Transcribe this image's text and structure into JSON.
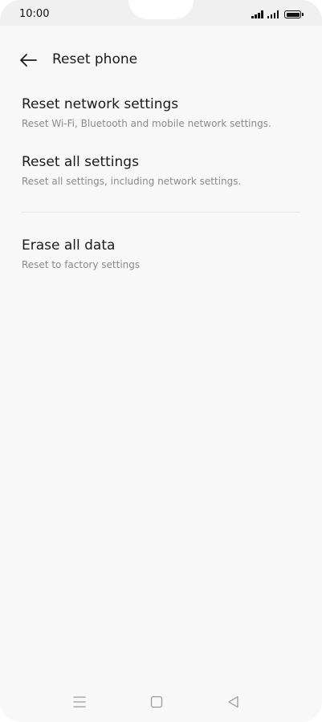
{
  "status_bar": {
    "time": "10:00",
    "icons": [
      "signal-1-icon",
      "signal-2-icon",
      "battery-icon"
    ]
  },
  "header": {
    "back_icon": "arrow-left-icon",
    "title": "Reset phone"
  },
  "items": [
    {
      "title": "Reset network settings",
      "subtitle": "Reset Wi-Fi, Bluetooth and mobile network settings."
    },
    {
      "title": "Reset all settings",
      "subtitle": "Reset all settings, including network settings."
    },
    {
      "title": "Erase all data",
      "subtitle": "Reset to factory settings"
    }
  ],
  "nav_bar": {
    "icons": [
      "menu-icon",
      "home-icon",
      "back-triangle-icon"
    ]
  },
  "colors": {
    "background": "#f8f8f8",
    "status_bar": "#f0f0f0",
    "title_text": "#1a1a1a",
    "subtitle_text": "#8a8a8a",
    "divider": "#e6e6e6"
  }
}
